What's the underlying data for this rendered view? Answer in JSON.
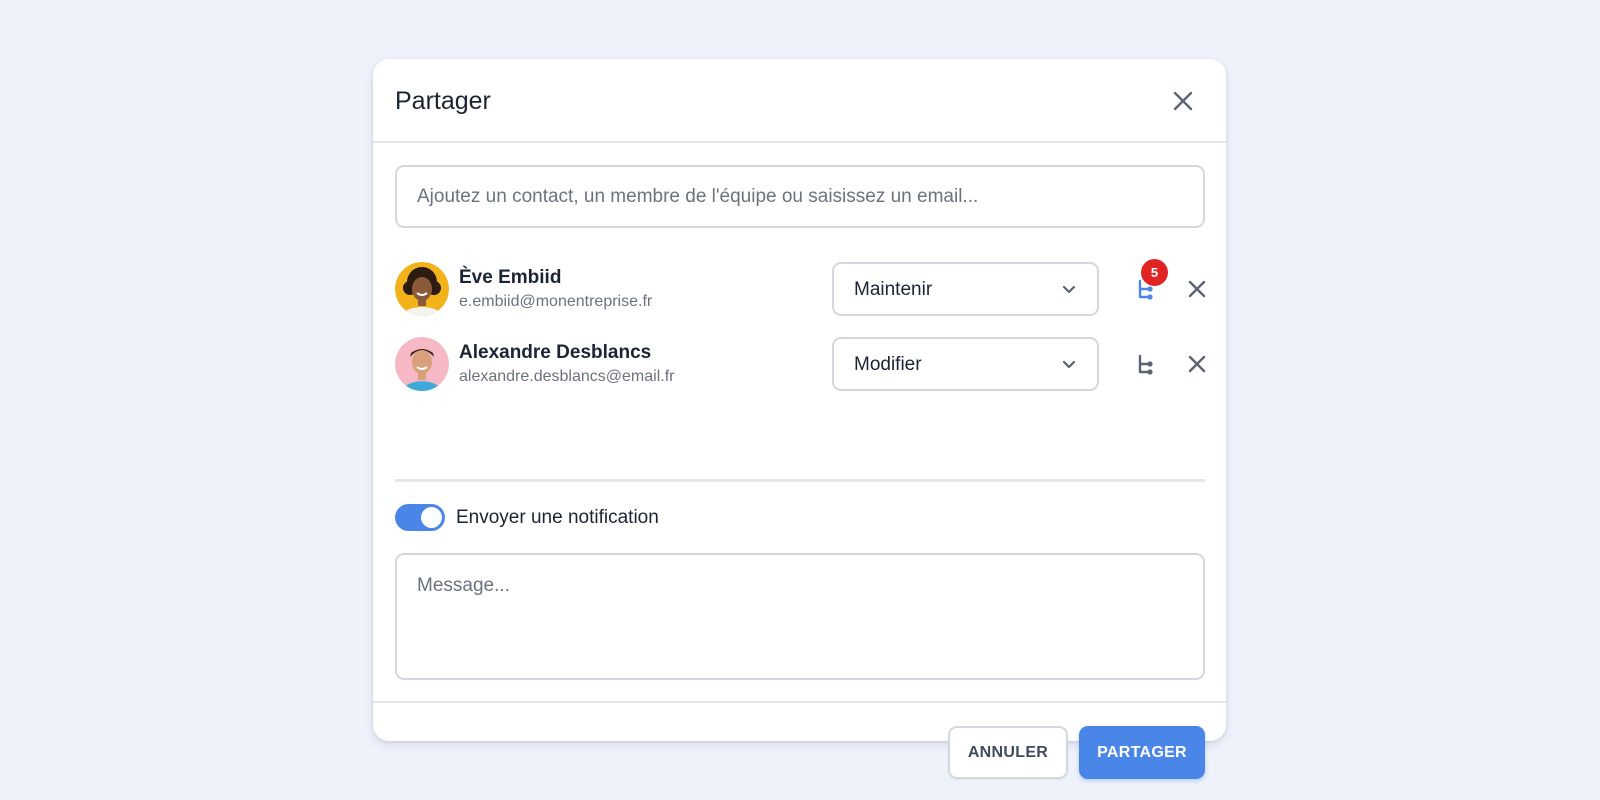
{
  "dialog": {
    "title": "Partager",
    "close_icon": "close-icon"
  },
  "search": {
    "placeholder": "Ajoutez un contact, un membre de l'équipe ou saisissez un email...",
    "value": ""
  },
  "users": [
    {
      "name": "Ève Embiid",
      "email": "e.embiid@monentreprise.fr",
      "role": "Maintenir",
      "hierarchy_badge": "5",
      "hierarchy_icon": "hierarchy-icon",
      "hierarchy_icon_color": "#4a86e8",
      "avatar_bg": "#f2b21a"
    },
    {
      "name": "Alexandre Desblancs",
      "email": "alexandre.desblancs@email.fr",
      "role": "Modifier",
      "hierarchy_icon": "hierarchy-icon",
      "hierarchy_icon_color": "#5b6474",
      "avatar_bg": "#f5b8c4"
    }
  ],
  "notification": {
    "label": "Envoyer une notification",
    "enabled": true
  },
  "message": {
    "placeholder": "Message...",
    "value": ""
  },
  "footer": {
    "cancel_label": "ANNULER",
    "share_label": "PARTAGER"
  },
  "colors": {
    "accent": "#4a86e8",
    "badge": "#e02424",
    "background": "#eef2fb"
  }
}
